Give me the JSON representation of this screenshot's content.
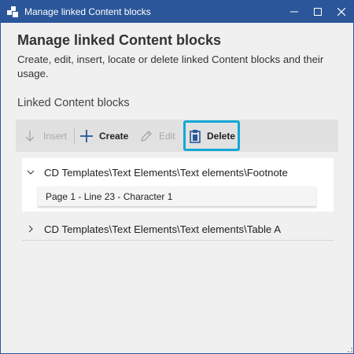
{
  "window": {
    "title": "Manage linked Content blocks",
    "controls": [
      "minimize",
      "maximize",
      "close"
    ]
  },
  "header": {
    "title": "Manage linked Content blocks",
    "description": "Create, edit, insert, locate or delete linked Content blocks and their usage."
  },
  "section": {
    "label": "Linked Content blocks"
  },
  "toolbar": {
    "insert_label": "Insert",
    "create_label": "Create",
    "edit_label": "Edit",
    "delete_label": "Delete"
  },
  "tree": {
    "items": [
      {
        "label": "CD Templates\\Text Elements\\Text elements\\Footnote",
        "expanded": true,
        "usages": [
          "Page 1 - Line 23 - Character 1"
        ]
      },
      {
        "label": "CD Templates\\Text Elements\\Text elements\\Table A",
        "expanded": false,
        "usages": []
      }
    ]
  },
  "colors": {
    "titlebar": "#2b579a",
    "highlight": "#13a8d4",
    "toolbar": "#e1e1e1",
    "window_bg": "#f0f0f0"
  },
  "icons": {
    "app": "content-blocks-icon",
    "insert": "arrow-down-icon",
    "create": "plus-icon",
    "edit": "pencil-icon",
    "delete": "clipboard-delete-icon",
    "expand": "chevron-down-icon",
    "collapse": "chevron-right-icon"
  }
}
